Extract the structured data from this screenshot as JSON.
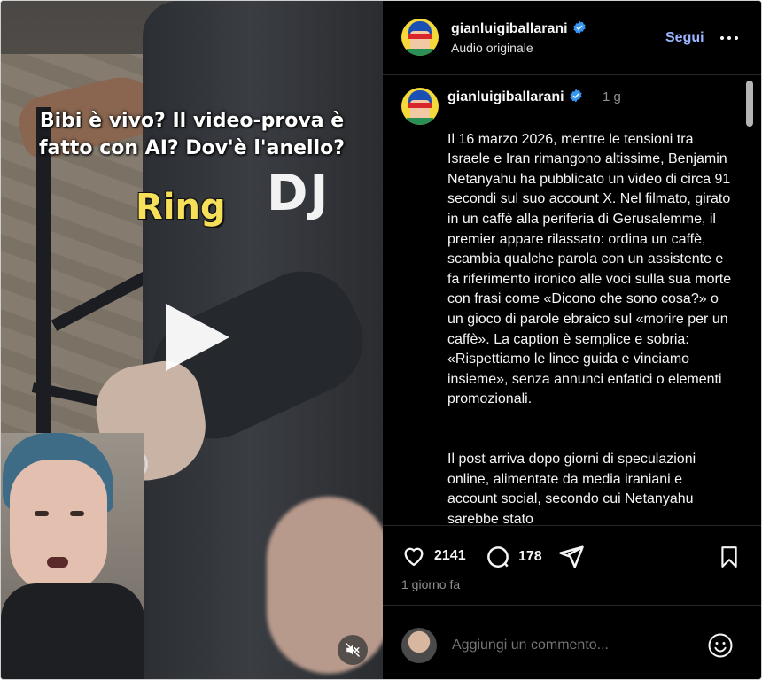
{
  "video": {
    "overlay_line1": "Bibi è vivo? Il video-prova è",
    "overlay_line2": "fatto con AI? Dov'è l'anello?",
    "ring_label": "Ring",
    "sign_text": "DJ"
  },
  "header": {
    "username": "gianluigiballarani",
    "subtitle": "Audio originale",
    "follow_label": "Segui"
  },
  "caption": {
    "username": "gianluigiballarani",
    "time": "1 g",
    "paragraph1": "Il 16 marzo 2026, mentre le tensioni tra Israele e Iran rimangono altissime, Benjamin Netanyahu ha pubblicato un video di circa 91 secondi sul suo account X. Nel filmato, girato in un caffè alla periferia di Gerusalemme, il premier appare rilassato: ordina un caffè, scambia qualche parola con un assistente e fa riferimento ironico alle voci sulla sua morte con frasi come «Dicono che sono cosa?» o un gioco di parole ebraico sul «morire per un caffè». La caption è semplice e sobria: «Rispettiamo le linee guida e vinciamo insieme», senza annunci enfatici o elementi promozionali.",
    "paragraph2": "Il post arriva dopo giorni di speculazioni online, alimentate da media iraniani e account social, secondo cui Netanyahu sarebbe stato"
  },
  "actions": {
    "likes": "2141",
    "comments": "178",
    "posted": "1 giorno fa"
  },
  "comment_box": {
    "placeholder": "Aggiungi un commento..."
  },
  "colors": {
    "background": "#000000",
    "follow": "#9ab6ff",
    "verified": "#3797f0",
    "ring_label": "#f6e05a"
  }
}
